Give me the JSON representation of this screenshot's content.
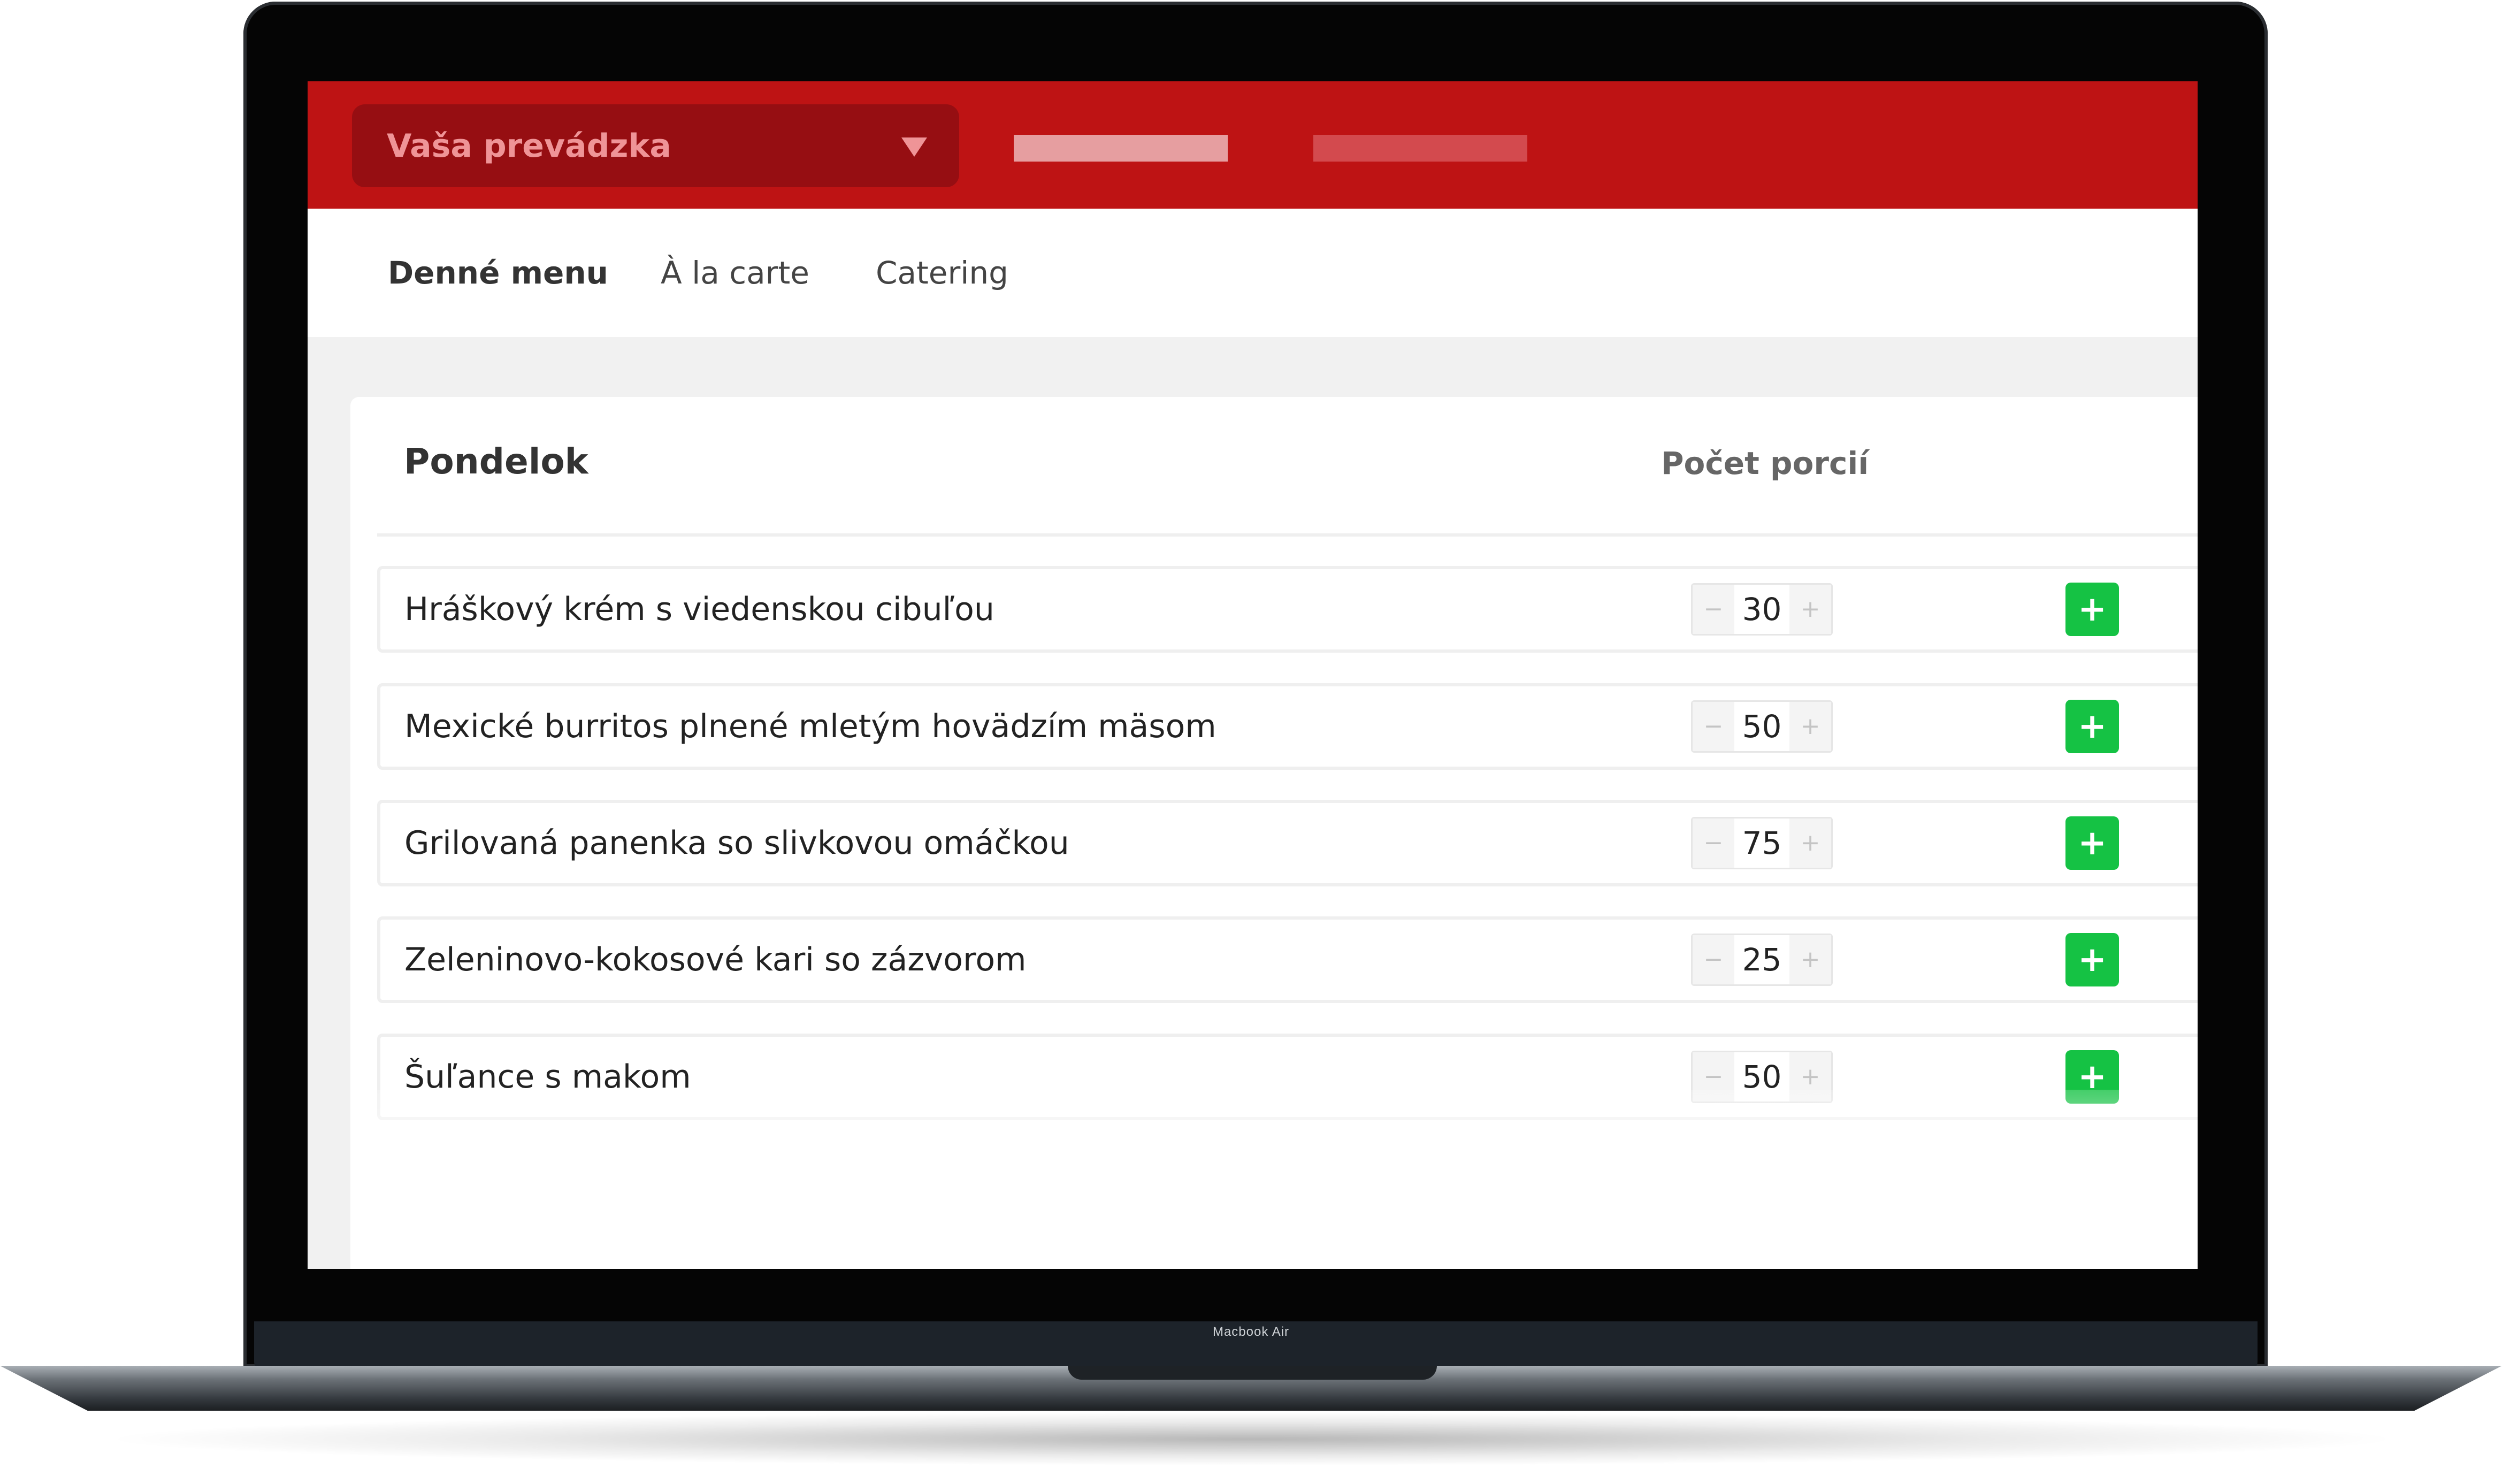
{
  "device": {
    "brand_label": "Macbook Air"
  },
  "header": {
    "venue_select": {
      "label": "Vaša prevádzka"
    }
  },
  "tabs": [
    {
      "label": "Denné menu",
      "active": true
    },
    {
      "label": "À la carte",
      "active": false
    },
    {
      "label": "Catering",
      "active": false
    }
  ],
  "menu": {
    "day": "Pondelok",
    "portions_header": "Počet porcií",
    "items": [
      {
        "name": "Hráškový krém s viedenskou cibuľou",
        "portions": "30"
      },
      {
        "name": "Mexické burritos plnené mletým hovädzím mäsom",
        "portions": "50"
      },
      {
        "name": "Grilovaná panenka so slivkovou omáčkou",
        "portions": "75"
      },
      {
        "name": "Zeleninovo-kokosové kari so zázvorom",
        "portions": "25"
      },
      {
        "name": "Šuľance s makom",
        "portions": "50"
      }
    ],
    "stepper": {
      "minus": "−",
      "plus": "+"
    },
    "add_button": "+"
  },
  "colors": {
    "brand_red": "#be1314",
    "select_bg": "#960e12",
    "add_green": "#15c244"
  }
}
